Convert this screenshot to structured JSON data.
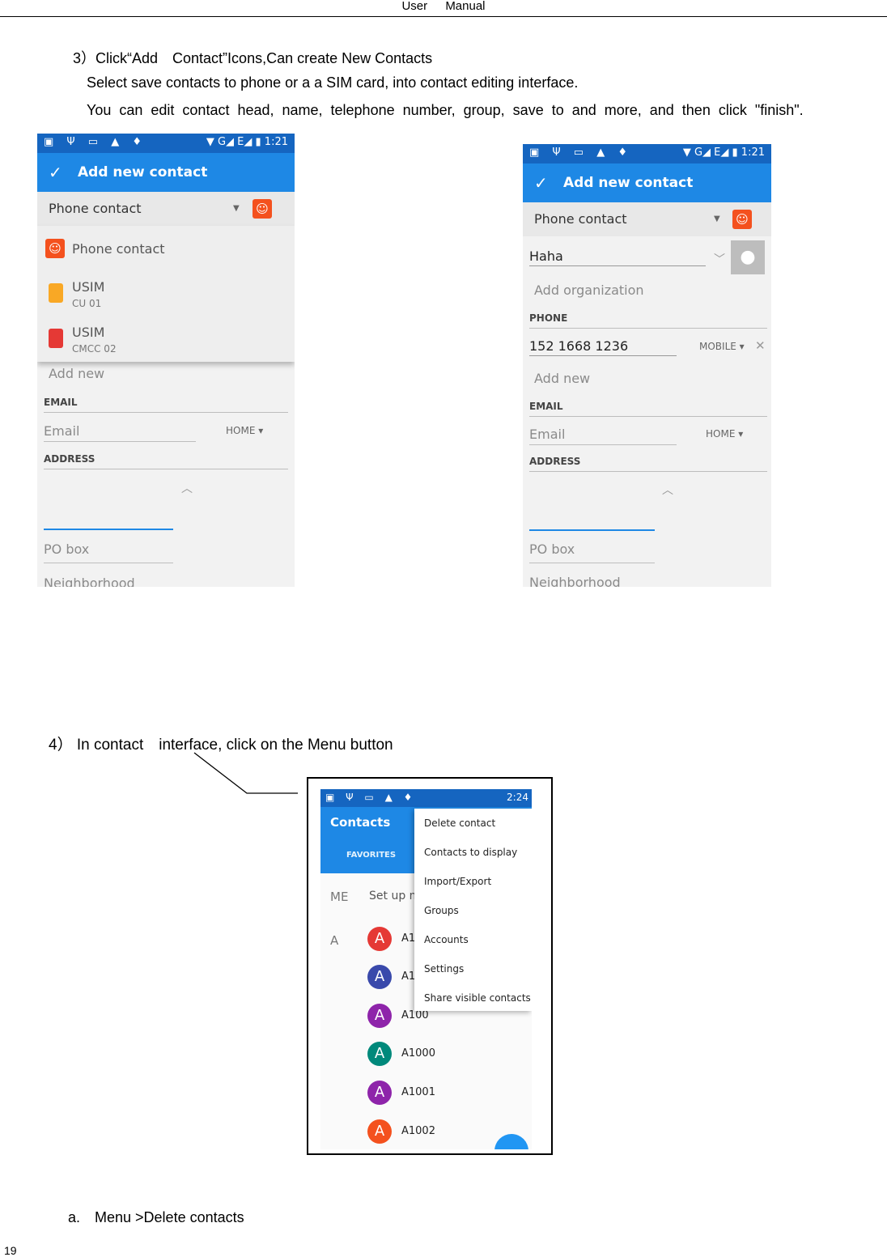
{
  "header": {
    "left": "User",
    "right": "Manual"
  },
  "step3": {
    "title": "3）Click“Add　Contact”Icons,Can create New Contacts",
    "line1": "Select save contacts to phone or a a SIM card, into contact editing interface.",
    "line2": "You can edit contact head, name, telephone number, group, save to and more, and then click \"finish\"."
  },
  "phone": {
    "status_time": "1:21",
    "status_right": "▼ G◢ E◢ ▮",
    "status_left": "▣ Ψ ▭ ▲ ♦",
    "appbar_title": "Add new contact",
    "account": "Phone contact",
    "add_new": "Add new",
    "email_section": "EMAIL",
    "email_placeholder": "Email",
    "email_type": "HOME",
    "address_section": "ADDRESS",
    "po_box": "PO box",
    "neighborhood": "Neighborhood"
  },
  "dropdown": {
    "items": [
      {
        "title": "Phone contact",
        "sub": ""
      },
      {
        "title": "USIM",
        "sub": "CU 01"
      },
      {
        "title": "USIM",
        "sub": "CMCC 02"
      }
    ],
    "colors": {
      "usim1": "#f9a825",
      "usim2": "#e53935"
    }
  },
  "phone2": {
    "name_value": "Haha",
    "org_placeholder": "Add organization",
    "phone_section": "PHONE",
    "phone_value": "152 1668 1236",
    "phone_type": "MOBILE"
  },
  "step4": {
    "title": "4） In contact　interface, click on the Menu button"
  },
  "contacts": {
    "status_time": "2:24",
    "app_title": "Contacts",
    "tab_favorites": "FAVORITES",
    "me_label": "ME",
    "setup_text": "Set up m",
    "section_letter": "A",
    "avatar_letter": "A",
    "rows": [
      {
        "name": "A1",
        "color": "#e53935"
      },
      {
        "name": "A1",
        "color": "#3949ab"
      },
      {
        "name": "A100",
        "color": "#8e24aa"
      },
      {
        "name": "A1000",
        "color": "#00897b"
      },
      {
        "name": "A1001",
        "color": "#8e24aa"
      },
      {
        "name": "A1002",
        "color": "#f4511e"
      }
    ],
    "menu": [
      "Delete contact",
      "Contacts to display",
      "Import/Export",
      "Groups",
      "Accounts",
      "Settings",
      "Share visible contacts"
    ]
  },
  "sub_a": "a.　Menu >Delete contacts",
  "page_number": "19"
}
